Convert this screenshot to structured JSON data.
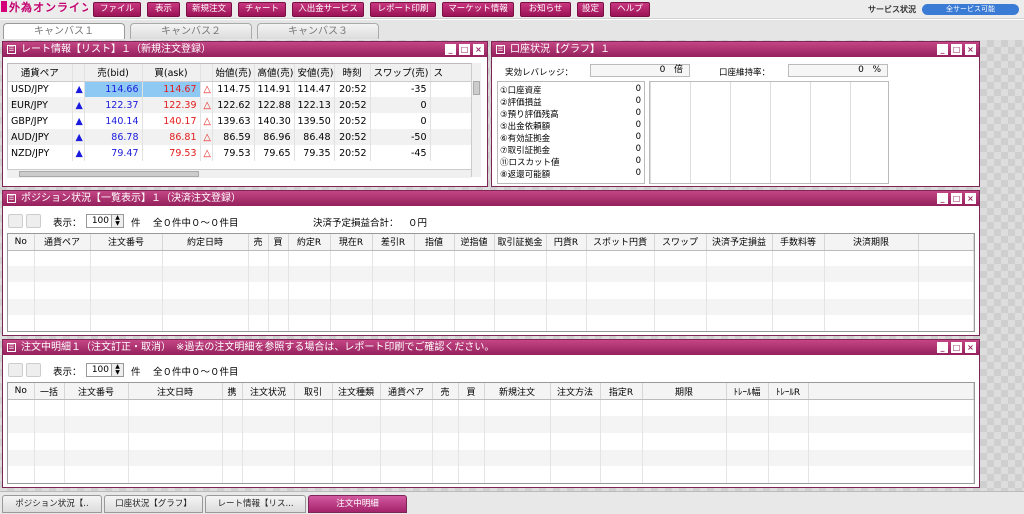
{
  "app": {
    "logo_text": "外為オンライン"
  },
  "menu": [
    {
      "label": "ファイル",
      "name": "file"
    },
    {
      "label": "表示",
      "name": "view"
    },
    {
      "label": "新規注文",
      "name": "new-order"
    },
    {
      "label": "チャート",
      "name": "chart"
    },
    {
      "label": "入出金サービス",
      "name": "deposit-withdraw"
    },
    {
      "label": "レポート印刷",
      "name": "report-print"
    },
    {
      "label": "マーケット情報",
      "name": "market-info"
    },
    {
      "label": "お知らせ",
      "name": "notice"
    },
    {
      "label": "設定",
      "name": "settings"
    },
    {
      "label": "ヘルプ",
      "name": "help"
    }
  ],
  "service": {
    "label": "サービス状況",
    "status": "全サービス可能"
  },
  "canvas_tabs": [
    {
      "label": "キャンバス１",
      "active": true
    },
    {
      "label": "キャンバス２",
      "active": false
    },
    {
      "label": "キャンバス３",
      "active": false
    }
  ],
  "rate_panel": {
    "title": "レート情報【リスト】１（新規注文登録）",
    "columns": [
      "通貨ペア",
      "",
      "売(bid)",
      "買(ask)",
      "",
      "始値(売)",
      "高値(売)",
      "安値(売)",
      "時刻",
      "スワップ(売)",
      "ス"
    ],
    "rows": [
      {
        "pair": "USD/JPY",
        "bid": "114.66",
        "ask": "114.67",
        "open": "114.75",
        "high": "114.91",
        "low": "114.47",
        "time": "20:52",
        "swap": "-35"
      },
      {
        "pair": "EUR/JPY",
        "bid": "122.37",
        "ask": "122.39",
        "open": "122.62",
        "high": "122.88",
        "low": "122.13",
        "time": "20:52",
        "swap": "0"
      },
      {
        "pair": "GBP/JPY",
        "bid": "140.14",
        "ask": "140.17",
        "open": "139.63",
        "high": "140.30",
        "low": "139.50",
        "time": "20:52",
        "swap": "0"
      },
      {
        "pair": "AUD/JPY",
        "bid": "86.78",
        "ask": "86.81",
        "open": "86.59",
        "high": "86.96",
        "low": "86.48",
        "time": "20:52",
        "swap": "-50"
      },
      {
        "pair": "NZD/JPY",
        "bid": "79.47",
        "ask": "79.53",
        "open": "79.53",
        "high": "79.65",
        "low": "79.35",
        "time": "20:52",
        "swap": "-45"
      }
    ]
  },
  "account_panel": {
    "title": "口座状況【グラフ】１",
    "leverage_label": "実効レバレッジ：",
    "leverage_value": "0",
    "leverage_unit": "倍",
    "margin_label": "口座維持率：",
    "margin_value": "0",
    "margin_unit": "%",
    "items": [
      {
        "label": "①口座資産",
        "value": "0"
      },
      {
        "label": "②評価損益",
        "value": "0"
      },
      {
        "label": "③預り評価残高",
        "value": "0"
      },
      {
        "label": "⑤出金依頼額",
        "value": "0"
      },
      {
        "label": "⑥有効証拠金",
        "value": "0"
      },
      {
        "label": "⑦取引証拠金",
        "value": "0"
      },
      {
        "label": "⑪ロスカット値",
        "value": "0"
      },
      {
        "label": "⑧返還可能額",
        "value": "0"
      }
    ]
  },
  "position_panel": {
    "title": "ポジション状況【一覧表示】１（決済注文登録）",
    "display_label": "表示：",
    "display_count": "100",
    "count_unit": "件",
    "count_text": "全０件中０～０件目",
    "pnl_label": "決済予定損益合計：",
    "pnl_value": "０円",
    "columns": [
      "No",
      "通貨ペア",
      "注文番号",
      "約定日時",
      "売",
      "買",
      "約定R",
      "現在R",
      "差引R",
      "指値",
      "逆指値",
      "取引証拠金",
      "円貨R",
      "スポット円貨",
      "スワップ",
      "決済予定損益",
      "手数料等",
      "決済期限"
    ]
  },
  "order_panel": {
    "title": "注文中明細１（注文訂正・取消）　※過去の注文明細を参照する場合は、レポート印刷でご確認ください。",
    "display_label": "表示：",
    "display_count": "100",
    "count_unit": "件",
    "count_text": "全０件中０～０件目",
    "columns": [
      "No",
      "一括",
      "注文番号",
      "注文日時",
      "携",
      "注文状況",
      "取引",
      "注文種類",
      "通貨ペア",
      "売",
      "買",
      "新規注文",
      "注文方法",
      "指定R",
      "期限",
      "ﾄﾚｰﾙ幅",
      "ﾄﾚｰﾙR"
    ]
  },
  "bottom_tabs": [
    {
      "label": "ポジション状況【..",
      "active": false
    },
    {
      "label": "口座状況【グラフ】",
      "active": false
    },
    {
      "label": "レート情報【リス...",
      "active": false
    },
    {
      "label": "注文中明細",
      "active": true
    }
  ]
}
